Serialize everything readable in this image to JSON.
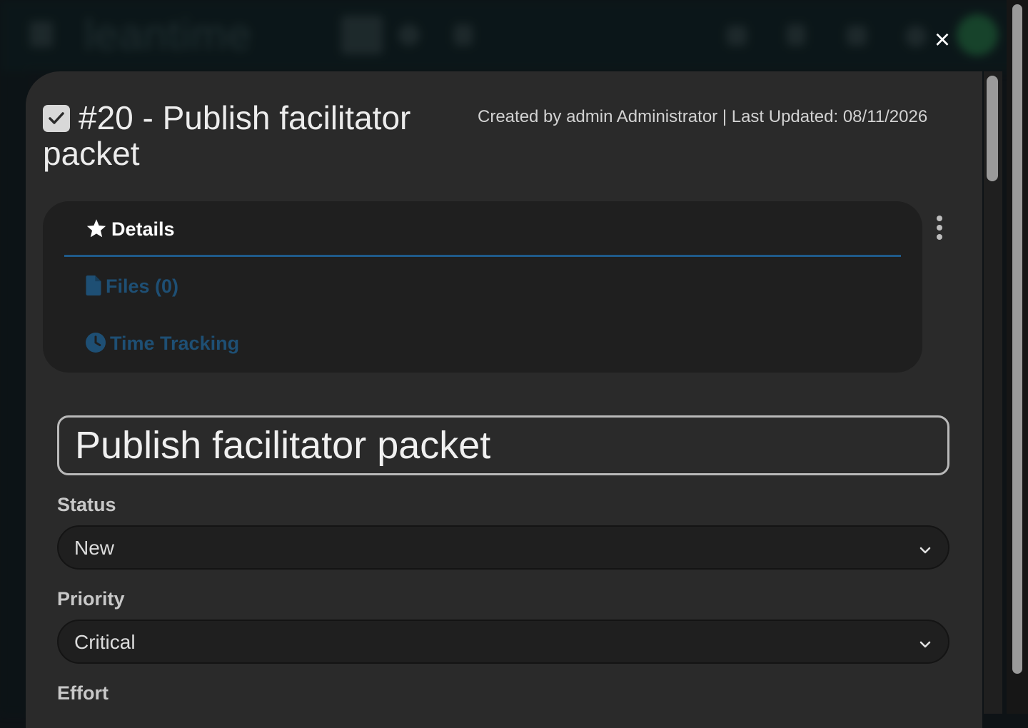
{
  "background": {
    "logo_text": "leantime"
  },
  "modal": {
    "close_label": "×",
    "title": "#20 - Publish facilitator packet",
    "meta": "Created by admin Administrator | Last Updated: 08/11/2026"
  },
  "tabs": {
    "details": "Details",
    "files": "Files (0)",
    "time_tracking": "Time Tracking"
  },
  "form": {
    "headline_value": "Publish facilitator packet",
    "status_label": "Status",
    "status_value": "New",
    "priority_label": "Priority",
    "priority_value": "Critical",
    "effort_label": "Effort"
  },
  "icons": {
    "title": "checkbox-checked-icon",
    "details": "star-icon",
    "files": "file-icon",
    "time_tracking": "clock-icon",
    "menu": "kebab-vertical-icon",
    "select": "chevron-down-icon",
    "close": "close-icon"
  },
  "colors": {
    "accent": "#1f5a8a",
    "tab_inactive": "#1e4f74",
    "modal_bg": "#2a2a2a",
    "panel_bg": "#1f1f1f"
  }
}
